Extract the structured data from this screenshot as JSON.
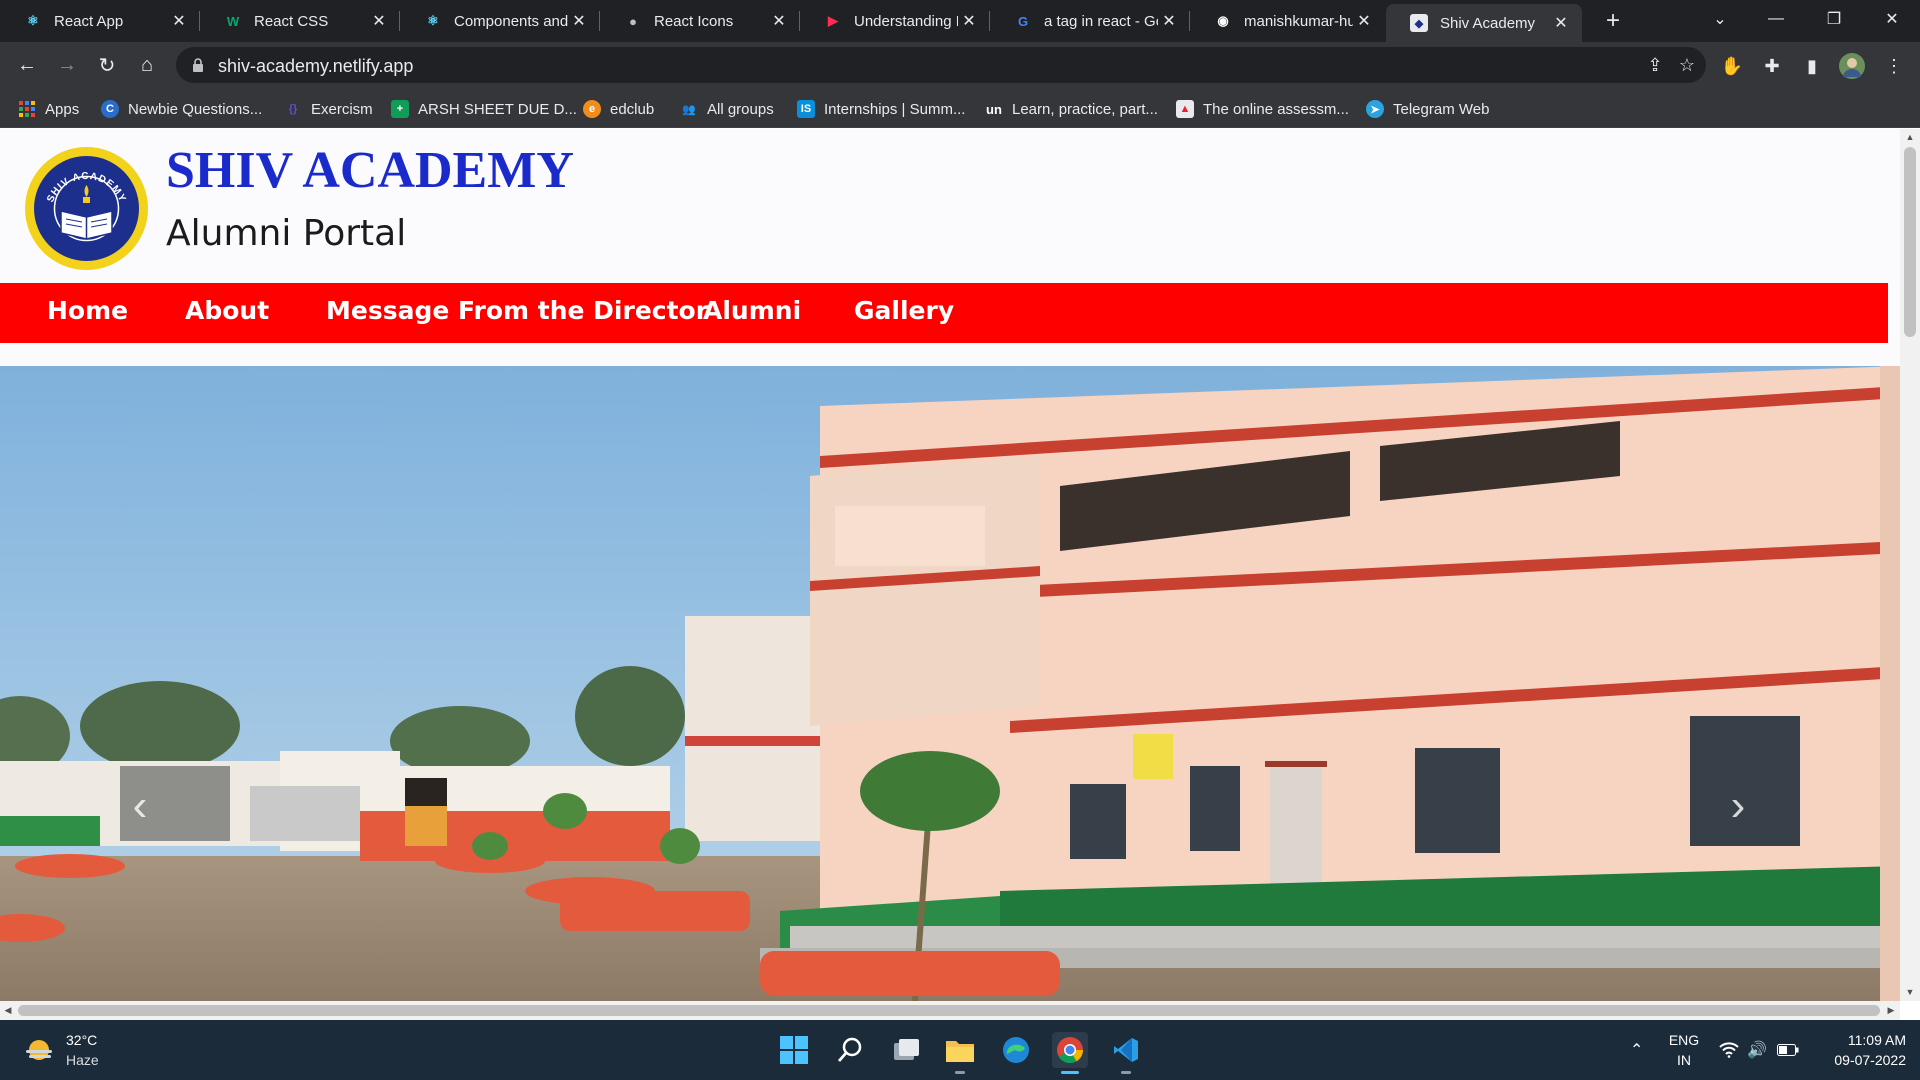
{
  "browser": {
    "tabs": [
      {
        "title": "React App",
        "icon": "react-icon",
        "active": false
      },
      {
        "title": "React CSS",
        "icon": "w3schools-icon",
        "active": false
      },
      {
        "title": "Components and",
        "icon": "react-icon",
        "active": false
      },
      {
        "title": "React Icons",
        "icon": "globe-icon",
        "active": false
      },
      {
        "title": "Understanding Li",
        "icon": "video-icon",
        "active": false
      },
      {
        "title": "a tag in react - Go",
        "icon": "google-icon",
        "active": false
      },
      {
        "title": "manishkumar-hul",
        "icon": "github-icon",
        "active": false
      },
      {
        "title": "Shiv Academy",
        "icon": "shiv-academy-icon",
        "active": true
      }
    ],
    "url": "shiv-academy.netlify.app",
    "bookmarks": [
      {
        "label": "Apps",
        "icon": "apps-grid-icon"
      },
      {
        "label": "Newbie Questions...",
        "icon": "codechef-icon"
      },
      {
        "label": "Exercism",
        "icon": "exercism-icon"
      },
      {
        "label": "ARSH SHEET DUE D...",
        "icon": "sheets-icon"
      },
      {
        "label": "edclub",
        "icon": "edclub-icon"
      },
      {
        "label": "All groups",
        "icon": "groups-icon"
      },
      {
        "label": "Internships | Summ...",
        "icon": "internshala-icon"
      },
      {
        "label": "Learn, practice, part...",
        "icon": "unstop-icon"
      },
      {
        "label": "The online assessm...",
        "icon": "assessment-icon"
      },
      {
        "label": "Telegram Web",
        "icon": "telegram-icon"
      }
    ]
  },
  "site": {
    "name": "SHIV ACADEMY",
    "subtitle": "Alumni Portal",
    "logo_text": "SHIV ACADEMY",
    "nav": [
      "Home",
      "About",
      "Message From the Director",
      "Alumni",
      "Gallery"
    ],
    "colors": {
      "nav_bg": "#ff0000",
      "title": "#1a2acb"
    }
  },
  "taskbar": {
    "weather": {
      "temp": "32°C",
      "desc": "Haze"
    },
    "language": {
      "line1": "ENG",
      "line2": "IN"
    },
    "clock": {
      "time": "11:09 AM",
      "date": "09-07-2022"
    }
  }
}
